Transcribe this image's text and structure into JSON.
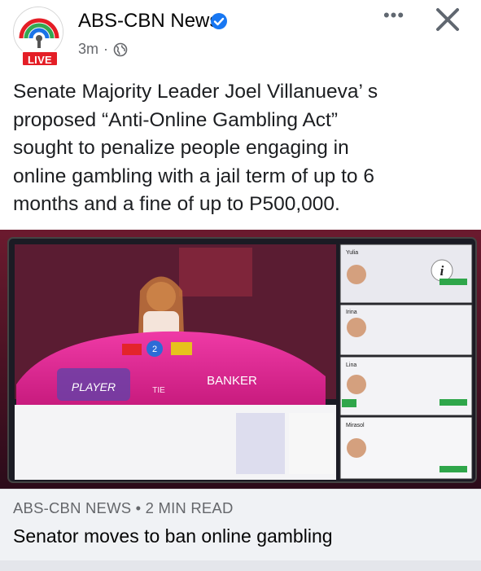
{
  "post": {
    "page_name": "ABS-CBN News",
    "live_label": "LIVE",
    "time_ago": "3m",
    "separator": "·",
    "more_label": "•••",
    "caption_lines": [
      "Senate Majority Leader Joel Villanueva’ s",
      "proposed “Anti-Online Gambling Act”",
      "sought to penalize people engaging in",
      "online gambling with a jail term of up to 6",
      "months and a fine of up to P500,000."
    ]
  },
  "media": {
    "player_label": "PLAYER",
    "tie_label": "TIE",
    "banker_label": "BANKER",
    "dealer_names": [
      "Yulia",
      "Irina",
      "Lina",
      "Mirasol"
    ],
    "chip_value": "2",
    "info_label": "i"
  },
  "link_preview": {
    "domain": "ABS-CBN NEWS • 2 MIN READ",
    "title": "Senator moves to ban online gambling"
  },
  "colors": {
    "live_red": "#e41e26",
    "verified_blue": "#1877f2",
    "table_pink": "#e0268f",
    "link_bg": "#f0f2f5"
  },
  "icons": [
    "abs-cbn-logo-icon",
    "verified-icon",
    "globe-icon",
    "more-icon",
    "close-icon",
    "info-icon"
  ]
}
